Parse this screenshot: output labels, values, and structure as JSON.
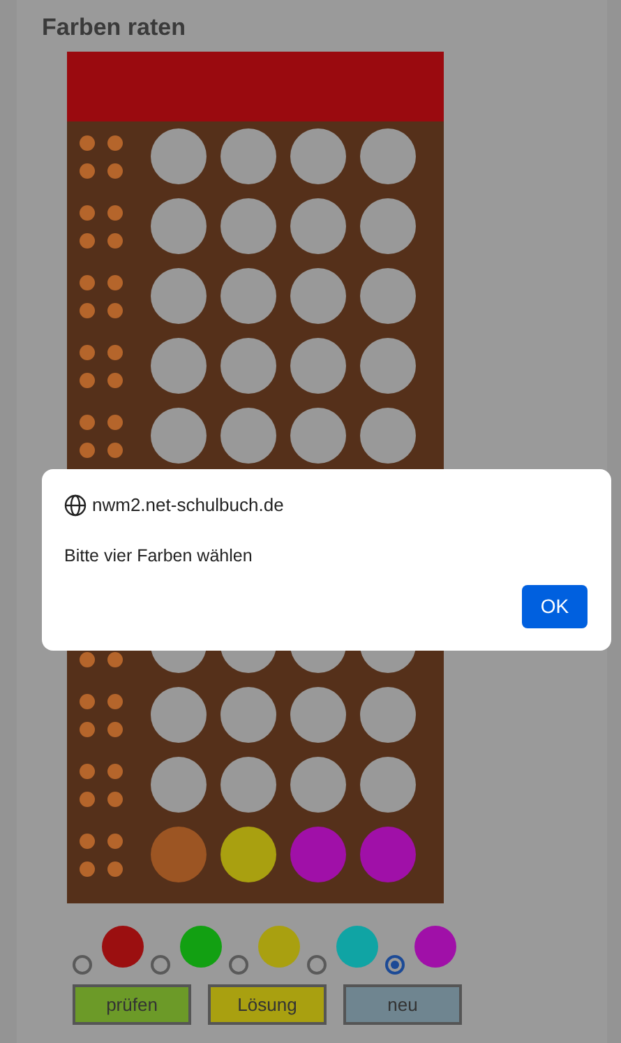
{
  "title": "Farben raten",
  "rows": [
    {
      "pegs": [
        {
          "filled": false
        },
        {
          "filled": false
        },
        {
          "filled": false
        },
        {
          "filled": false
        }
      ]
    },
    {
      "pegs": [
        {
          "filled": false
        },
        {
          "filled": false
        },
        {
          "filled": false
        },
        {
          "filled": false
        }
      ]
    },
    {
      "pegs": [
        {
          "filled": false
        },
        {
          "filled": false
        },
        {
          "filled": false
        },
        {
          "filled": false
        }
      ]
    },
    {
      "pegs": [
        {
          "filled": false
        },
        {
          "filled": false
        },
        {
          "filled": false
        },
        {
          "filled": false
        }
      ]
    },
    {
      "pegs": [
        {
          "filled": false
        },
        {
          "filled": false
        },
        {
          "filled": false
        },
        {
          "filled": false
        }
      ]
    },
    {
      "pegs": [
        {
          "filled": false
        },
        {
          "filled": false
        },
        {
          "filled": false
        },
        {
          "filled": false
        }
      ]
    },
    {
      "pegs": [
        {
          "filled": false
        },
        {
          "filled": false
        },
        {
          "filled": false
        },
        {
          "filled": false
        }
      ]
    },
    {
      "pegs": [
        {
          "filled": false
        },
        {
          "filled": false
        },
        {
          "filled": false
        },
        {
          "filled": false
        }
      ]
    },
    {
      "pegs": [
        {
          "filled": true,
          "color": "#9c5523"
        },
        {
          "filled": true,
          "color": "#a9a010"
        },
        {
          "filled": true,
          "color": "#a010a8"
        },
        {
          "filled": true,
          "color": "#a010a8"
        }
      ]
    }
  ],
  "palette": [
    {
      "color": "#9b0f10",
      "selected": false
    },
    {
      "color": "#12a012",
      "selected": false
    },
    {
      "color": "#a9a010",
      "selected": false
    },
    {
      "color": "#10a4a4",
      "selected": false
    },
    {
      "color": "#a010a8",
      "selected": true
    }
  ],
  "buttons": [
    {
      "label": "prüfen",
      "color": "#6c9a28"
    },
    {
      "label": "Lösung",
      "color": "#a9a010"
    },
    {
      "label": "neu",
      "color": "#6f8590"
    }
  ],
  "dialog": {
    "origin": "nwm2.net-schulbuch.de",
    "message": "Bitte vier Farben wählen",
    "button": "OK"
  }
}
